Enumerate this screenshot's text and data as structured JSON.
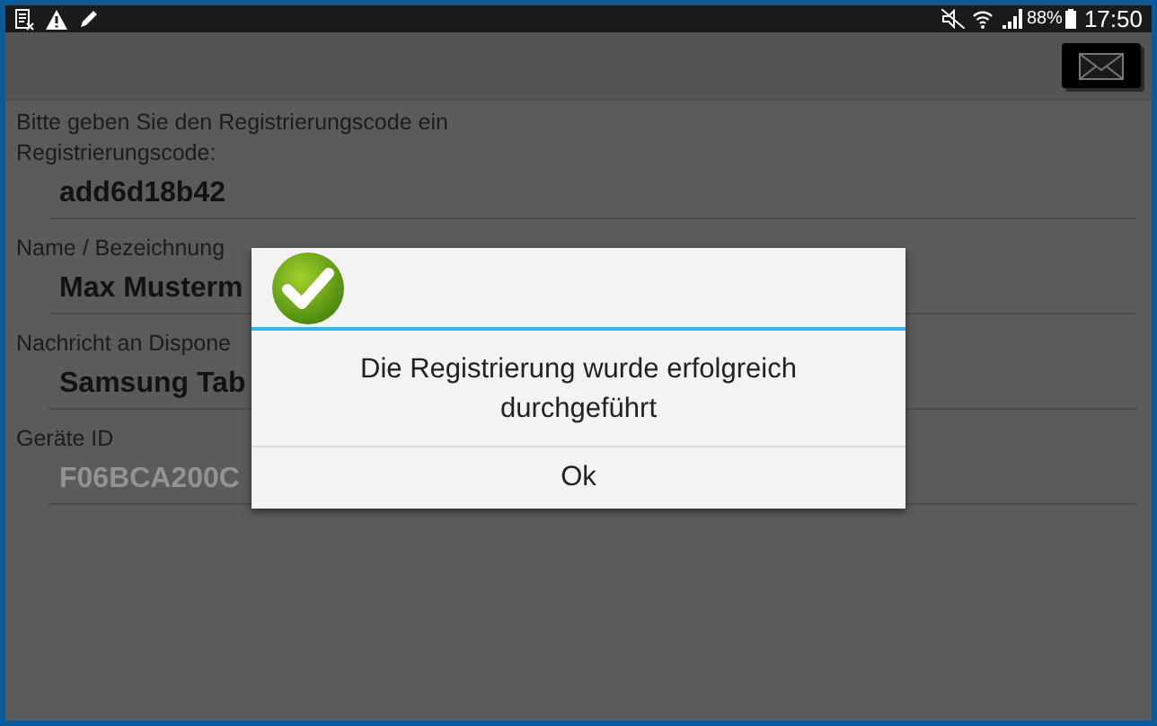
{
  "status_bar": {
    "battery": "88%",
    "time": "17:50"
  },
  "intro": "Bitte geben Sie den Registrierungscode ein",
  "fields": [
    {
      "label": "Registrierungscode:",
      "value": "add6d18b42",
      "disabled": false
    },
    {
      "label": "Name / Bezeichnung",
      "value": "Max Musterm",
      "disabled": false
    },
    {
      "label": "Nachricht an Dispone",
      "value": "Samsung Tab",
      "disabled": false
    },
    {
      "label": "Geräte ID",
      "value": "F06BCA200C",
      "disabled": true
    }
  ],
  "dialog": {
    "message": "Die Registrierung wurde erfolgreich durchgeführt",
    "button": "Ok"
  }
}
